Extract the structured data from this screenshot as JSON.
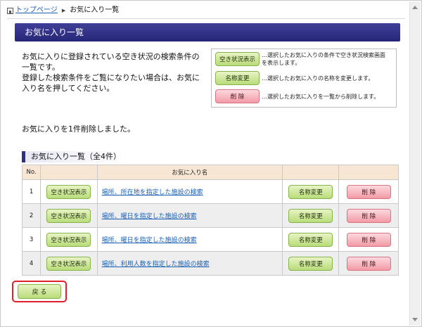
{
  "breadcrumb": {
    "home_label": "トップページ",
    "current_label": "お気に入り一覧"
  },
  "page": {
    "title": "お気に入り一覧",
    "intro_lines": [
      "お気に入りに登録されている空き状況の検索条件の一覧です。",
      "登録した検索条件をご覧になりたい場合は、お気に入り名を押してください。"
    ],
    "message": "お気に入りを1件削除しました。"
  },
  "legend": [
    {
      "button": "空き状況表示",
      "style": "green",
      "desc": "…選択したお気に入りの条件で空き状況検索画面を表示します。"
    },
    {
      "button": "名称変更",
      "style": "green",
      "desc": "…選択したお気に入りの名称を変更します。"
    },
    {
      "button": "削 除",
      "style": "red",
      "desc": "…選択したお気に入りを一覧から削除します。"
    }
  ],
  "list": {
    "section_title": "お気に入り一覧（全4件）",
    "headers": {
      "no": "No.",
      "name": "お気に入り名"
    },
    "rows": [
      {
        "no": "1",
        "vacancy": "空き状況表示",
        "name": "場所、所在地を指定した施設の検索",
        "rename": "名称変更",
        "delete": "削 除"
      },
      {
        "no": "2",
        "vacancy": "空き状況表示",
        "name": "場所、曜日を指定した施設の検索",
        "rename": "名称変更",
        "delete": "削 除"
      },
      {
        "no": "3",
        "vacancy": "空き状況表示",
        "name": "場所、曜日を指定した施設の検索",
        "rename": "名称変更",
        "delete": "削 除"
      },
      {
        "no": "4",
        "vacancy": "空き状況表示",
        "name": "場所、利用人数を指定した施設の検索",
        "rename": "名称変更",
        "delete": "削 除"
      }
    ]
  },
  "back_button": "戻 る",
  "colors": {
    "header_bar": "#2f2f87",
    "button_green": "#b9dc7a",
    "button_red": "#f29aa6",
    "table_header": "#f7e6d3",
    "highlight": "#e0202a",
    "link": "#1a5fb4"
  }
}
